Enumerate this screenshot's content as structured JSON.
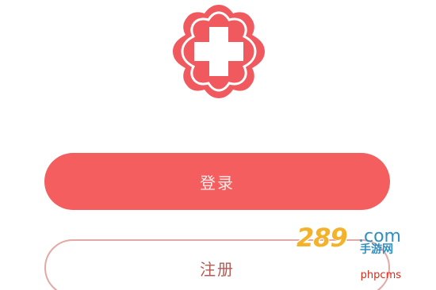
{
  "logo": {
    "icon": "medical-cross-icon",
    "color": "#f05a5f"
  },
  "buttons": {
    "login_label": "登录",
    "register_label": "注册",
    "primary_color": "#f45e5e",
    "secondary_border_color": "#e2a9a6"
  },
  "watermark": {
    "logo_text": "289",
    "domain": ".com",
    "subtitle": "手游网",
    "site_text": "phpcms"
  }
}
